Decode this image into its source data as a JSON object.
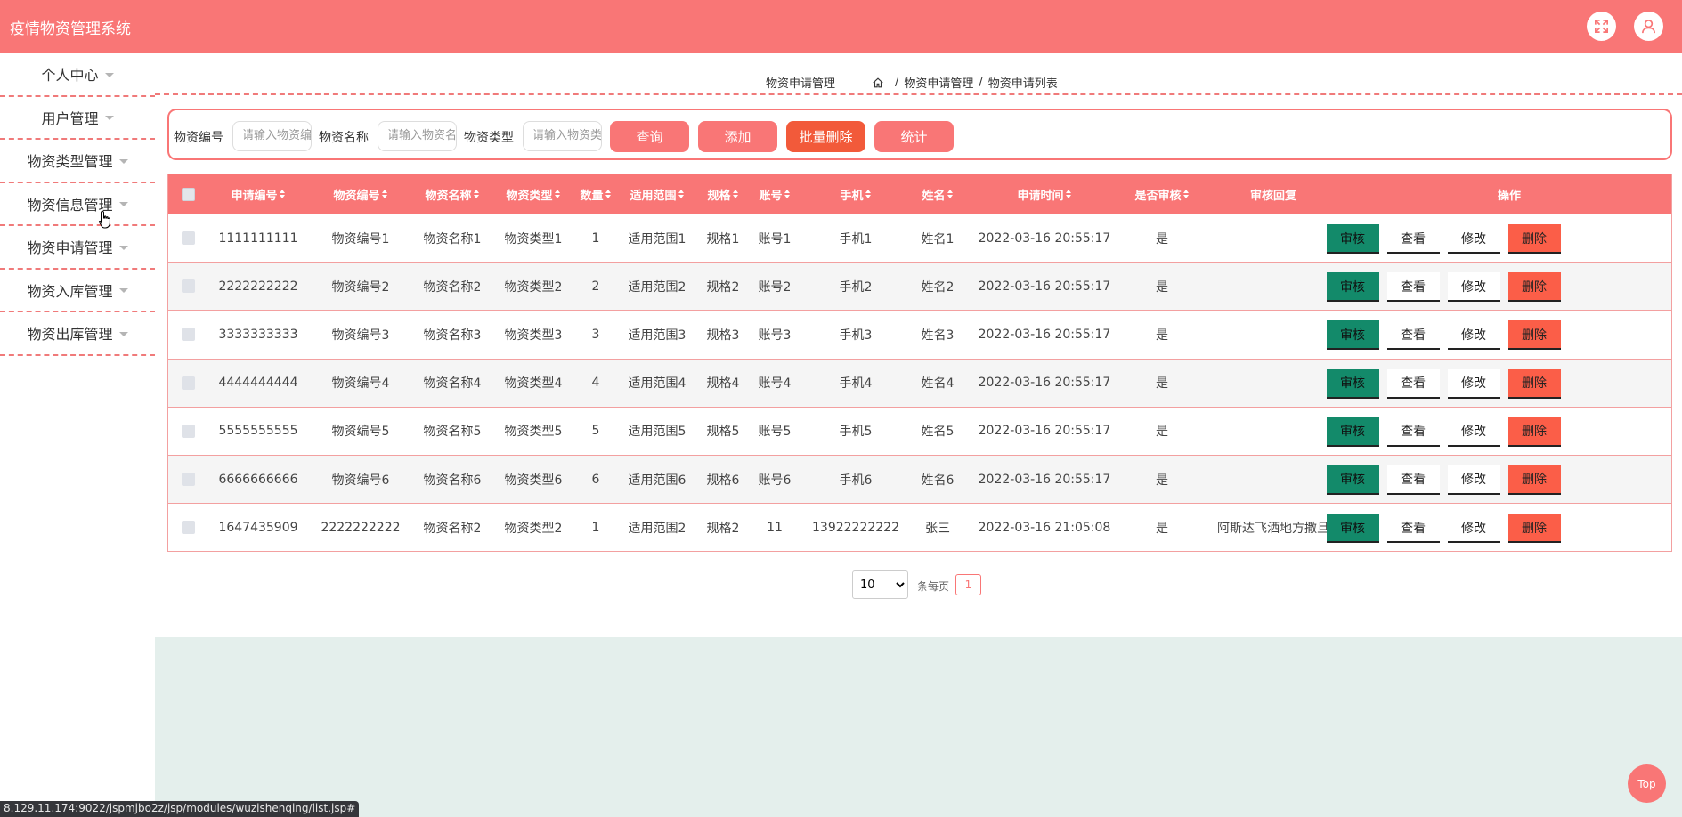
{
  "app": {
    "title": "疫情物资管理系统"
  },
  "header": {
    "fullscreen_icon": "fullscreen-icon",
    "user_icon": "user-icon"
  },
  "sidebar": {
    "items": [
      {
        "label": "个人中心"
      },
      {
        "label": "用户管理"
      },
      {
        "label": "物资类型管理"
      },
      {
        "label": "物资信息管理"
      },
      {
        "label": "物资申请管理"
      },
      {
        "label": "物资入库管理"
      },
      {
        "label": "物资出库管理"
      }
    ]
  },
  "breadcrumb": {
    "page_label": "物资申请管理",
    "home_icon": "home-icon",
    "sep": "/",
    "level1": "物资申请管理",
    "level2": "物资申请列表"
  },
  "search": {
    "fields": [
      {
        "label": "物资编号",
        "placeholder": "请输入物资编号"
      },
      {
        "label": "物资名称",
        "placeholder": "请输入物资名称"
      },
      {
        "label": "物资类型",
        "placeholder": "请输入物资类型"
      }
    ],
    "buttons": {
      "query": "查询",
      "add": "添加",
      "batch_delete": "批量删除",
      "stats": "统计"
    }
  },
  "table": {
    "columns": [
      "申请编号",
      "物资编号",
      "物资名称",
      "物资类型",
      "数量",
      "适用范围",
      "规格",
      "账号",
      "手机",
      "姓名",
      "申请时间",
      "是否审核",
      "审核回复",
      "操作"
    ],
    "actions": {
      "audit": "审核",
      "view": "查看",
      "edit": "修改",
      "delete": "删除"
    },
    "rows": [
      [
        "1111111111",
        "物资编号1",
        "物资名称1",
        "物资类型1",
        "1",
        "适用范围1",
        "规格1",
        "账号1",
        "手机1",
        "姓名1",
        "2022-03-16 20:55:17",
        "是",
        ""
      ],
      [
        "2222222222",
        "物资编号2",
        "物资名称2",
        "物资类型2",
        "2",
        "适用范围2",
        "规格2",
        "账号2",
        "手机2",
        "姓名2",
        "2022-03-16 20:55:17",
        "是",
        ""
      ],
      [
        "3333333333",
        "物资编号3",
        "物资名称3",
        "物资类型3",
        "3",
        "适用范围3",
        "规格3",
        "账号3",
        "手机3",
        "姓名3",
        "2022-03-16 20:55:17",
        "是",
        ""
      ],
      [
        "4444444444",
        "物资编号4",
        "物资名称4",
        "物资类型4",
        "4",
        "适用范围4",
        "规格4",
        "账号4",
        "手机4",
        "姓名4",
        "2022-03-16 20:55:17",
        "是",
        ""
      ],
      [
        "5555555555",
        "物资编号5",
        "物资名称5",
        "物资类型5",
        "5",
        "适用范围5",
        "规格5",
        "账号5",
        "手机5",
        "姓名5",
        "2022-03-16 20:55:17",
        "是",
        ""
      ],
      [
        "6666666666",
        "物资编号6",
        "物资名称6",
        "物资类型6",
        "6",
        "适用范围6",
        "规格6",
        "账号6",
        "手机6",
        "姓名6",
        "2022-03-16 20:55:17",
        "是",
        ""
      ],
      [
        "1647435909",
        "2222222222",
        "物资名称2",
        "物资类型2",
        "1",
        "适用范围2",
        "规格2",
        "11",
        "13922222222",
        "张三",
        "2022-03-16 21:05:08",
        "是",
        "阿斯达飞洒地方撒旦"
      ]
    ]
  },
  "pagination": {
    "page_size": "10",
    "per_page_label": "条每页",
    "current_page": "1"
  },
  "misc": {
    "top_button": "Top",
    "status_url": "8.129.11.174:9022/jspmjbo2z/jsp/modules/wuzishenqing/list.jsp#"
  },
  "colors": {
    "primary": "#f97676",
    "danger": "#f25a3a",
    "audit": "#138a6a",
    "footer": "#e4efec"
  }
}
